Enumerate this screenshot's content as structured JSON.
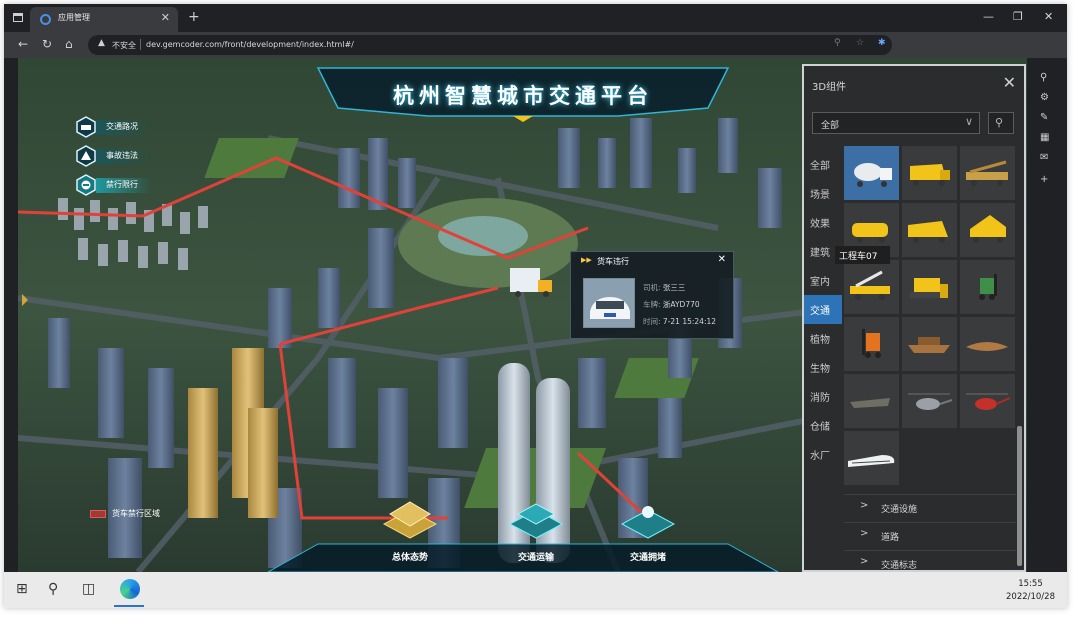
{
  "browser": {
    "tab_title": "应用管理",
    "tab_close": "✕",
    "new_tab": "+",
    "url_security": "不安全",
    "url": "dev.gemcoder.com/front/development/index.html#/"
  },
  "app": {
    "title": "杭州智慧城市交通平台",
    "left_menu": [
      {
        "label": "交通路况",
        "icon": "car-icon"
      },
      {
        "label": "事故违法",
        "icon": "warning-icon"
      },
      {
        "label": "禁行限行",
        "icon": "no-entry-icon",
        "active": true
      }
    ],
    "legend_label": "货车禁行区域",
    "bottom_nav": [
      {
        "label": "总体态势"
      },
      {
        "label": "交通运输"
      },
      {
        "label": "交通拥堵"
      }
    ],
    "popup": {
      "title": "货车违行",
      "close": "✕",
      "driver_key": "司机:",
      "driver_val": "张三三",
      "plate_key": "车牌:",
      "plate_val": "浙AYD770",
      "time_key": "时间:",
      "time_val": "7-21 15:24:12"
    }
  },
  "panel": {
    "title": "3D组件",
    "close": "✕",
    "filter_value": "全部",
    "categories": [
      "全部",
      "场景",
      "效果",
      "建筑",
      "室内",
      "交通",
      "植物",
      "生物",
      "消防",
      "仓储",
      "水厂"
    ],
    "active_category": "交通",
    "tooltip": "工程车07",
    "subsections": [
      "交通设施",
      "道路",
      "交通标志"
    ],
    "chevron": ">"
  },
  "taskbar": {
    "time": "15:55",
    "date": "2022/10/28"
  },
  "colors": {
    "accent": "#2c73b8",
    "banner_glow": "#3fd7ff",
    "route_red": "#e0423a",
    "truck_yellow": "#f2c318"
  }
}
